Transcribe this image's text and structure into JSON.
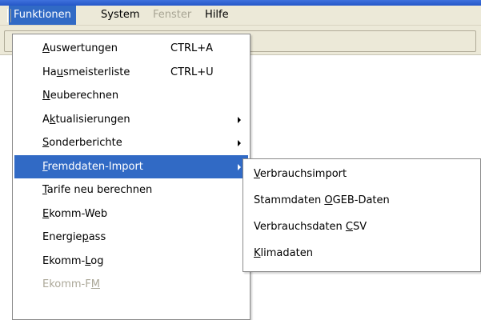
{
  "menubar": {
    "items": [
      {
        "label": "Funktionen",
        "state": "active"
      },
      {
        "label": "System",
        "state": "normal"
      },
      {
        "label": "Fenster",
        "state": "disabled"
      },
      {
        "label": "Hilfe",
        "state": "normal"
      }
    ]
  },
  "menu": {
    "items": [
      {
        "pre": "",
        "key": "A",
        "post": "uswertungen",
        "shortcut": "CTRL+A"
      },
      {
        "pre": "Ha",
        "key": "u",
        "post": "smeisterliste",
        "shortcut": "CTRL+U"
      },
      {
        "pre": "",
        "key": "N",
        "post": "euberechnen",
        "shortcut": ""
      },
      {
        "pre": "A",
        "key": "k",
        "post": "tualisierungen",
        "shortcut": "",
        "submenu": true
      },
      {
        "pre": "",
        "key": "S",
        "post": "onderberichte",
        "shortcut": "",
        "submenu": true
      },
      {
        "pre": "",
        "key": "F",
        "post": "remddaten-Import",
        "shortcut": "",
        "submenu": true,
        "highlighted": true
      },
      {
        "pre": "",
        "key": "T",
        "post": "arife neu berechnen",
        "shortcut": ""
      },
      {
        "pre": "",
        "key": "E",
        "post": "komm-Web",
        "shortcut": ""
      },
      {
        "pre": "Energie",
        "key": "p",
        "post": "ass",
        "shortcut": ""
      },
      {
        "pre": "Ekomm-",
        "key": "L",
        "post": "og",
        "shortcut": ""
      },
      {
        "pre": "Ekomm-F",
        "key": "M",
        "post": "",
        "shortcut": "",
        "disabled": true
      }
    ]
  },
  "submenu": {
    "items": [
      {
        "pre": "",
        "key": "V",
        "post": "erbrauchsimport"
      },
      {
        "pre": "Stammdaten ",
        "key": "O",
        "post": "GEB-Daten"
      },
      {
        "pre": "Verbrauchsdaten ",
        "key": "C",
        "post": "SV"
      },
      {
        "pre": "",
        "key": "K",
        "post": "limadaten"
      }
    ]
  },
  "icons": {
    "submenu_arrow": "triangle-right-icon",
    "toolbar_grip": "grip-icon"
  },
  "colors": {
    "highlight": "#316ac5",
    "menubar_bg": "#ece9d8",
    "disabled_text": "#aca899",
    "titlebar": "#2456c8"
  }
}
